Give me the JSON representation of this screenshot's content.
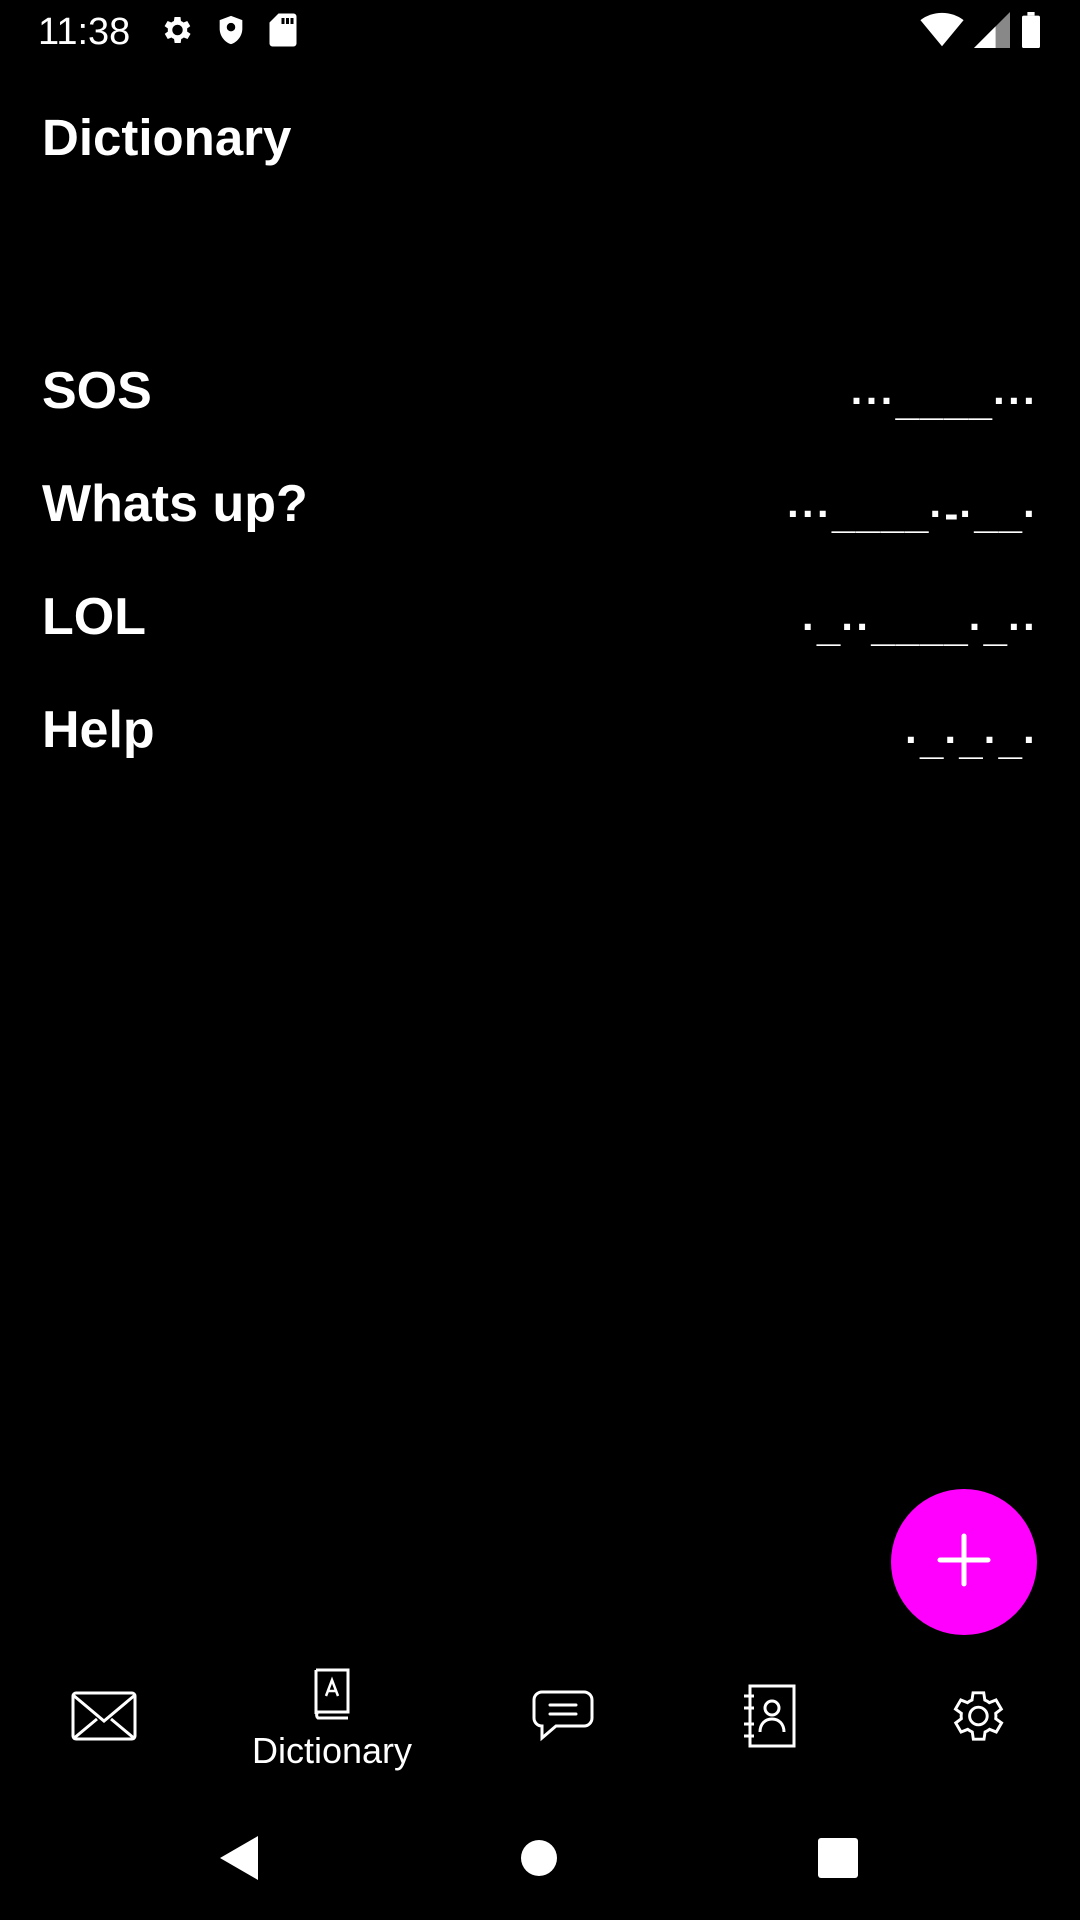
{
  "status_bar": {
    "time": "11:38"
  },
  "page": {
    "title": "Dictionary"
  },
  "entries": [
    {
      "word": "SOS",
      "code": "···____···"
    },
    {
      "word": "Whats up?",
      "code": "···____·-·__·"
    },
    {
      "word": "LOL",
      "code": "·_··____·_··"
    },
    {
      "word": "Help",
      "code": "·_·_·_·"
    }
  ],
  "fab": {
    "icon": "plus-icon"
  },
  "bottom_nav": [
    {
      "icon": "mail-icon",
      "label": ""
    },
    {
      "icon": "dictionary-icon",
      "label": "Dictionary",
      "active": true
    },
    {
      "icon": "chat-icon",
      "label": ""
    },
    {
      "icon": "contacts-icon",
      "label": ""
    },
    {
      "icon": "settings-icon",
      "label": ""
    }
  ],
  "colors": {
    "background": "#000000",
    "accent": "#ff00ff",
    "text": "#ffffff"
  }
}
